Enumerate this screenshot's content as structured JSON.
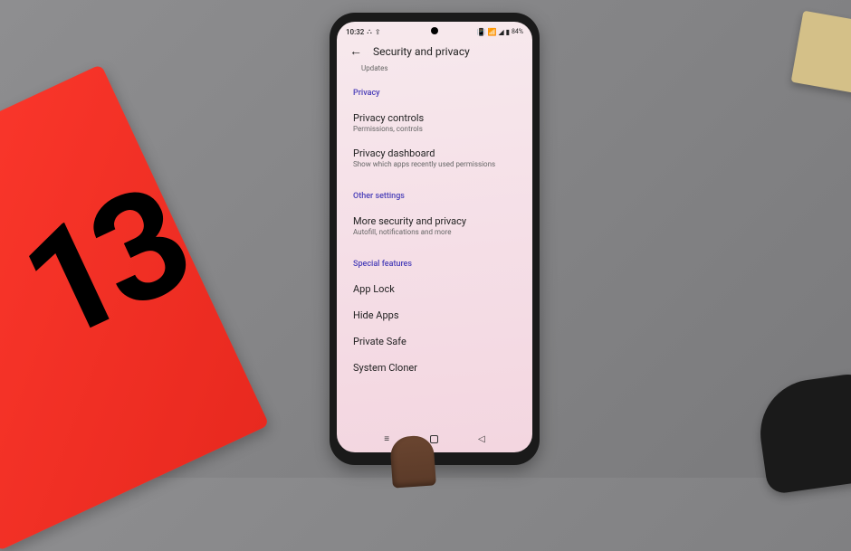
{
  "status_bar": {
    "time": "10:32",
    "battery": "84%"
  },
  "header": {
    "title": "Security and privacy"
  },
  "scroll_hint": "Updates",
  "sections": {
    "privacy": {
      "header": "Privacy",
      "items": {
        "controls": {
          "title": "Privacy controls",
          "sub": "Permissions, controls"
        },
        "dashboard": {
          "title": "Privacy dashboard",
          "sub": "Show which apps recently used permissions"
        }
      }
    },
    "other": {
      "header": "Other settings",
      "items": {
        "more": {
          "title": "More security and privacy",
          "sub": "Autofill, notifications and more"
        }
      }
    },
    "special": {
      "header": "Special features",
      "items": {
        "applock": {
          "title": "App Lock"
        },
        "hideapps": {
          "title": "Hide Apps"
        },
        "privatesafe": {
          "title": "Private Safe"
        },
        "cloner": {
          "title": "System Cloner"
        }
      }
    }
  },
  "box_label": "13"
}
